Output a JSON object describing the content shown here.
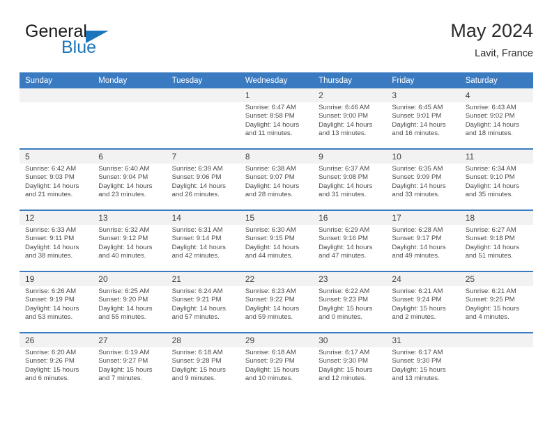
{
  "brand": {
    "name_part1": "General",
    "name_part2": "Blue",
    "accent_color": "#1b75bb"
  },
  "header": {
    "title": "May 2024",
    "location": "Lavit, France"
  },
  "theme": {
    "header_blue": "#3a7ac1",
    "daynum_band": "#f2f2f2",
    "text": "#4a4a4a"
  },
  "weekdays": [
    "Sunday",
    "Monday",
    "Tuesday",
    "Wednesday",
    "Thursday",
    "Friday",
    "Saturday"
  ],
  "weeks": [
    {
      "days": [
        {
          "num": "",
          "lines": []
        },
        {
          "num": "",
          "lines": []
        },
        {
          "num": "",
          "lines": []
        },
        {
          "num": "1",
          "lines": [
            "Sunrise: 6:47 AM",
            "Sunset: 8:58 PM",
            "Daylight: 14 hours",
            "and 11 minutes."
          ]
        },
        {
          "num": "2",
          "lines": [
            "Sunrise: 6:46 AM",
            "Sunset: 9:00 PM",
            "Daylight: 14 hours",
            "and 13 minutes."
          ]
        },
        {
          "num": "3",
          "lines": [
            "Sunrise: 6:45 AM",
            "Sunset: 9:01 PM",
            "Daylight: 14 hours",
            "and 16 minutes."
          ]
        },
        {
          "num": "4",
          "lines": [
            "Sunrise: 6:43 AM",
            "Sunset: 9:02 PM",
            "Daylight: 14 hours",
            "and 18 minutes."
          ]
        }
      ]
    },
    {
      "days": [
        {
          "num": "5",
          "lines": [
            "Sunrise: 6:42 AM",
            "Sunset: 9:03 PM",
            "Daylight: 14 hours",
            "and 21 minutes."
          ]
        },
        {
          "num": "6",
          "lines": [
            "Sunrise: 6:40 AM",
            "Sunset: 9:04 PM",
            "Daylight: 14 hours",
            "and 23 minutes."
          ]
        },
        {
          "num": "7",
          "lines": [
            "Sunrise: 6:39 AM",
            "Sunset: 9:06 PM",
            "Daylight: 14 hours",
            "and 26 minutes."
          ]
        },
        {
          "num": "8",
          "lines": [
            "Sunrise: 6:38 AM",
            "Sunset: 9:07 PM",
            "Daylight: 14 hours",
            "and 28 minutes."
          ]
        },
        {
          "num": "9",
          "lines": [
            "Sunrise: 6:37 AM",
            "Sunset: 9:08 PM",
            "Daylight: 14 hours",
            "and 31 minutes."
          ]
        },
        {
          "num": "10",
          "lines": [
            "Sunrise: 6:35 AM",
            "Sunset: 9:09 PM",
            "Daylight: 14 hours",
            "and 33 minutes."
          ]
        },
        {
          "num": "11",
          "lines": [
            "Sunrise: 6:34 AM",
            "Sunset: 9:10 PM",
            "Daylight: 14 hours",
            "and 35 minutes."
          ]
        }
      ]
    },
    {
      "days": [
        {
          "num": "12",
          "lines": [
            "Sunrise: 6:33 AM",
            "Sunset: 9:11 PM",
            "Daylight: 14 hours",
            "and 38 minutes."
          ]
        },
        {
          "num": "13",
          "lines": [
            "Sunrise: 6:32 AM",
            "Sunset: 9:12 PM",
            "Daylight: 14 hours",
            "and 40 minutes."
          ]
        },
        {
          "num": "14",
          "lines": [
            "Sunrise: 6:31 AM",
            "Sunset: 9:14 PM",
            "Daylight: 14 hours",
            "and 42 minutes."
          ]
        },
        {
          "num": "15",
          "lines": [
            "Sunrise: 6:30 AM",
            "Sunset: 9:15 PM",
            "Daylight: 14 hours",
            "and 44 minutes."
          ]
        },
        {
          "num": "16",
          "lines": [
            "Sunrise: 6:29 AM",
            "Sunset: 9:16 PM",
            "Daylight: 14 hours",
            "and 47 minutes."
          ]
        },
        {
          "num": "17",
          "lines": [
            "Sunrise: 6:28 AM",
            "Sunset: 9:17 PM",
            "Daylight: 14 hours",
            "and 49 minutes."
          ]
        },
        {
          "num": "18",
          "lines": [
            "Sunrise: 6:27 AM",
            "Sunset: 9:18 PM",
            "Daylight: 14 hours",
            "and 51 minutes."
          ]
        }
      ]
    },
    {
      "days": [
        {
          "num": "19",
          "lines": [
            "Sunrise: 6:26 AM",
            "Sunset: 9:19 PM",
            "Daylight: 14 hours",
            "and 53 minutes."
          ]
        },
        {
          "num": "20",
          "lines": [
            "Sunrise: 6:25 AM",
            "Sunset: 9:20 PM",
            "Daylight: 14 hours",
            "and 55 minutes."
          ]
        },
        {
          "num": "21",
          "lines": [
            "Sunrise: 6:24 AM",
            "Sunset: 9:21 PM",
            "Daylight: 14 hours",
            "and 57 minutes."
          ]
        },
        {
          "num": "22",
          "lines": [
            "Sunrise: 6:23 AM",
            "Sunset: 9:22 PM",
            "Daylight: 14 hours",
            "and 59 minutes."
          ]
        },
        {
          "num": "23",
          "lines": [
            "Sunrise: 6:22 AM",
            "Sunset: 9:23 PM",
            "Daylight: 15 hours",
            "and 0 minutes."
          ]
        },
        {
          "num": "24",
          "lines": [
            "Sunrise: 6:21 AM",
            "Sunset: 9:24 PM",
            "Daylight: 15 hours",
            "and 2 minutes."
          ]
        },
        {
          "num": "25",
          "lines": [
            "Sunrise: 6:21 AM",
            "Sunset: 9:25 PM",
            "Daylight: 15 hours",
            "and 4 minutes."
          ]
        }
      ]
    },
    {
      "days": [
        {
          "num": "26",
          "lines": [
            "Sunrise: 6:20 AM",
            "Sunset: 9:26 PM",
            "Daylight: 15 hours",
            "and 6 minutes."
          ]
        },
        {
          "num": "27",
          "lines": [
            "Sunrise: 6:19 AM",
            "Sunset: 9:27 PM",
            "Daylight: 15 hours",
            "and 7 minutes."
          ]
        },
        {
          "num": "28",
          "lines": [
            "Sunrise: 6:18 AM",
            "Sunset: 9:28 PM",
            "Daylight: 15 hours",
            "and 9 minutes."
          ]
        },
        {
          "num": "29",
          "lines": [
            "Sunrise: 6:18 AM",
            "Sunset: 9:29 PM",
            "Daylight: 15 hours",
            "and 10 minutes."
          ]
        },
        {
          "num": "30",
          "lines": [
            "Sunrise: 6:17 AM",
            "Sunset: 9:30 PM",
            "Daylight: 15 hours",
            "and 12 minutes."
          ]
        },
        {
          "num": "31",
          "lines": [
            "Sunrise: 6:17 AM",
            "Sunset: 9:30 PM",
            "Daylight: 15 hours",
            "and 13 minutes."
          ]
        },
        {
          "num": "",
          "lines": []
        }
      ]
    }
  ]
}
